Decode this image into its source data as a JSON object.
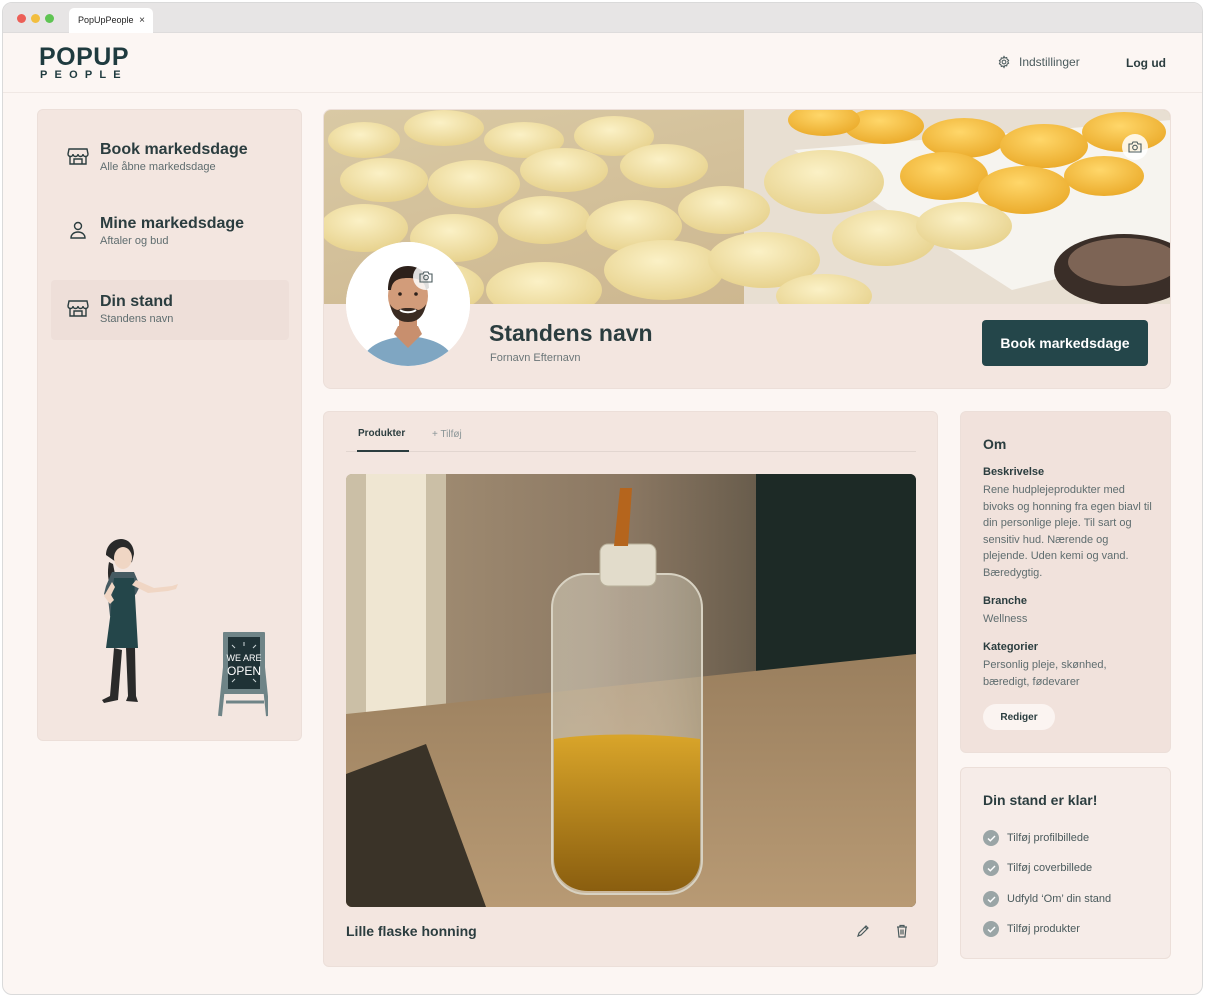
{
  "browser": {
    "tab_title": "PopUpPeople",
    "tab_close": "×"
  },
  "header": {
    "logo_top": "POPUP",
    "logo_bottom": "PEOPLE",
    "settings_label": "Indstillinger",
    "logout_label": "Log ud"
  },
  "sidebar": {
    "items": [
      {
        "title": "Book markedsdage",
        "subtitle": "Alle åbne markedsdage",
        "icon": "store-icon"
      },
      {
        "title": "Mine markedsdage",
        "subtitle": "Aftaler og bud",
        "icon": "person-icon"
      },
      {
        "title": "Din stand",
        "subtitle": "Standens navn",
        "icon": "store-icon",
        "active": true
      }
    ],
    "illustration_sign_line1": "WE ARE",
    "illustration_sign_line2": "OPEN"
  },
  "profile": {
    "stand_name": "Standens navn",
    "owner_name": "Fornavn Efternavn",
    "book_button": "Book markedsdage"
  },
  "products": {
    "tab_active": "Produkter",
    "tab_add": "+ Tilføj",
    "items": [
      {
        "name": "Lille flaske honning"
      }
    ]
  },
  "about": {
    "title": "Om",
    "description_label": "Beskrivelse",
    "description": "Rene hudplejeprodukter med bivoks og honning fra egen biavl til din personlige pleje. Til sart og sensitiv hud. Nærende og plejende. Uden kemi og vand. Bæredygtig.",
    "branche_label": "Branche",
    "branche": "Wellness",
    "kategorier_label": "Kategorier",
    "kategorier": "Personlig pleje, skønhed, bæredigt, fødevarer",
    "edit_button": "Rediger"
  },
  "ready": {
    "title": "Din stand er klar!",
    "items": [
      "Tilføj profilbillede",
      "Tilføj coverbillede",
      "Udfyld ‘Om’ din stand",
      "Tilføj produkter"
    ]
  },
  "colors": {
    "primary": "#24464a",
    "background": "#fcf6f3",
    "card": "#f3e6e0",
    "check": "#9aa5a6"
  }
}
